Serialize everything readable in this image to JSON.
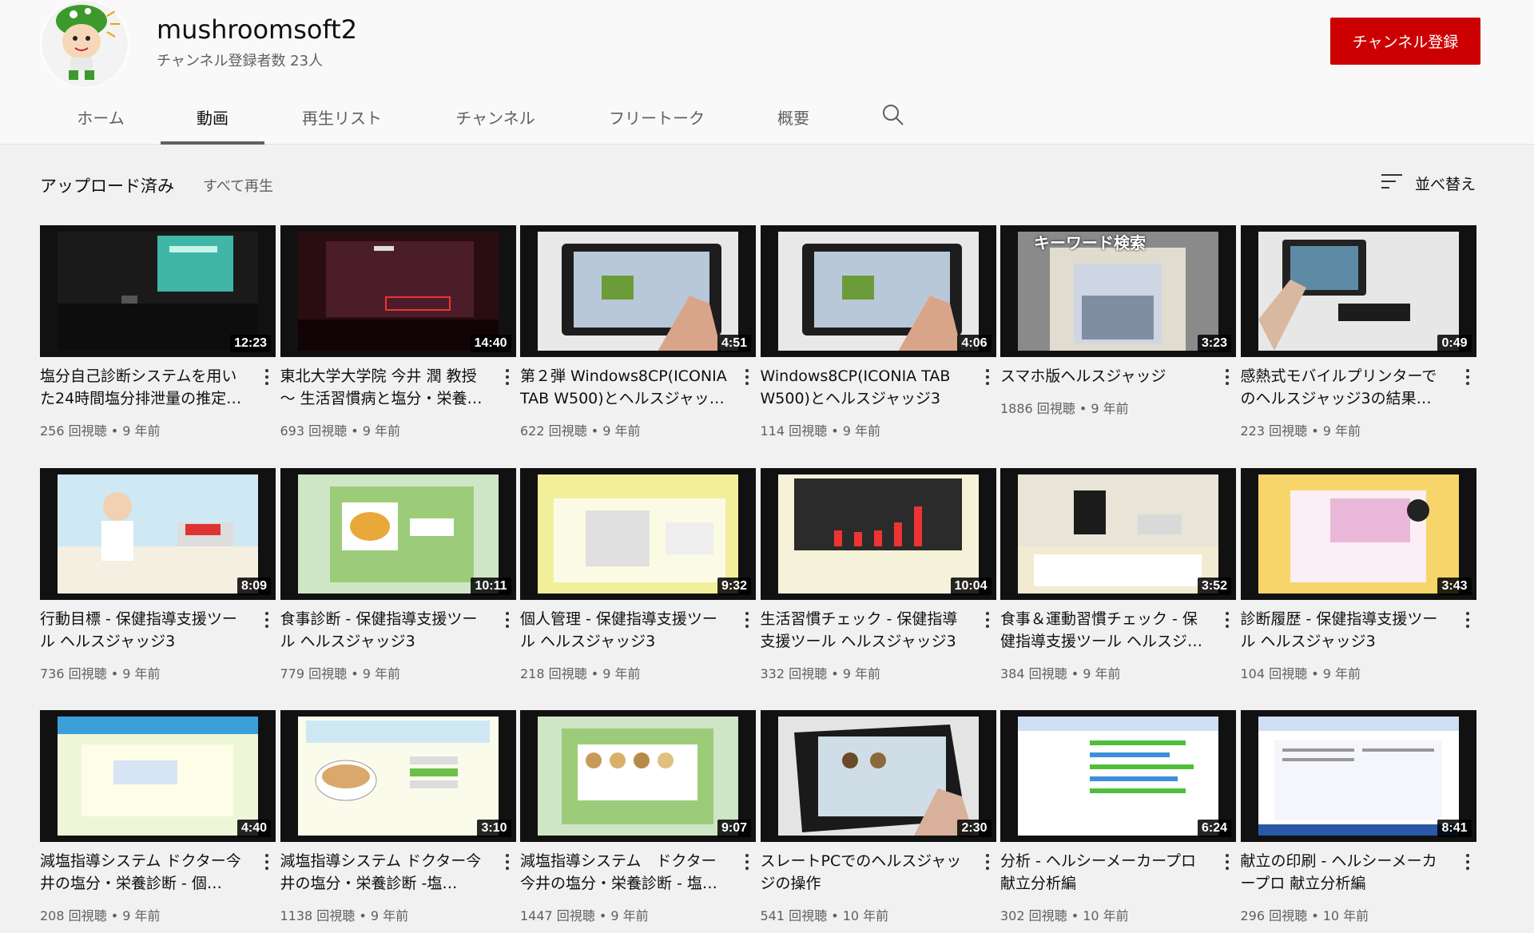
{
  "channel": {
    "name": "mushroomsoft2",
    "subscribers": "チャンネル登録者数 23人",
    "subscribe_label": "チャンネル登録"
  },
  "tabs": [
    {
      "label": "ホーム",
      "active": false
    },
    {
      "label": "動画",
      "active": true
    },
    {
      "label": "再生リスト",
      "active": false
    },
    {
      "label": "チャンネル",
      "active": false
    },
    {
      "label": "フリートーク",
      "active": false
    },
    {
      "label": "概要",
      "active": false
    }
  ],
  "section": {
    "title": "アップロード済み",
    "play_all": "すべて再生",
    "sort_label": "並べ替え"
  },
  "colors": {
    "subscribe": "#cc0000",
    "background": "#f1f1f1",
    "header": "#f9f9f9"
  },
  "videos": [
    {
      "title": "塩分自己診断システムを用いた24時間塩分排泄量の推定…",
      "meta": "256 回視聴 • 9 年前",
      "duration": "12:23",
      "thumb": "lecture"
    },
    {
      "title": "東北大学大学院 今井 潤 教授 ～ 生活習慣病と塩分・栄養…",
      "meta": "693 回視聴 • 9 年前",
      "duration": "14:40",
      "thumb": "lecture-dark"
    },
    {
      "title": "第２弾 Windows8CP(ICONIA TAB W500)とヘルスジャッ…",
      "meta": "622 回視聴 • 9 年前",
      "duration": "4:51",
      "thumb": "tablet"
    },
    {
      "title": "Windows8CP(ICONIA TAB W500)とヘルスジャッジ3",
      "meta": "114 回視聴 • 9 年前",
      "duration": "4:06",
      "thumb": "tablet"
    },
    {
      "title": "スマホ版ヘルスジャッジ",
      "meta": "1886 回視聴 • 9 年前",
      "duration": "3:23",
      "thumb": "phone",
      "overlay": "キーワード検索"
    },
    {
      "title": "感熱式モバイルプリンターでのヘルスジャッジ3の結果…",
      "meta": "223 回視聴 • 9 年前",
      "duration": "0:49",
      "thumb": "printer"
    },
    {
      "title": "行動目標 - 保健指導支援ツール ヘルスジャッジ3",
      "meta": "736 回視聴 • 9 年前",
      "duration": "8:09",
      "thumb": "doctor"
    },
    {
      "title": "食事診断 - 保健指導支援ツール ヘルスジャッジ3",
      "meta": "779 回視聴 • 9 年前",
      "duration": "10:11",
      "thumb": "food-app"
    },
    {
      "title": "個人管理 - 保健指導支援ツール ヘルスジャッジ3",
      "meta": "218 回視聴 • 9 年前",
      "duration": "9:32",
      "thumb": "yellow-app"
    },
    {
      "title": "生活習慣チェック - 保健指導支援ツール ヘルスジャッジ3",
      "meta": "332 回視聴 • 9 年前",
      "duration": "10:04",
      "thumb": "chart-app"
    },
    {
      "title": "食事＆運動習慣チェック - 保健指導支援ツール ヘルスジ…",
      "meta": "384 回視聴 • 9 年前",
      "duration": "3:52",
      "thumb": "room-app"
    },
    {
      "title": "診断履歴 - 保健指導支援ツール ヘルスジャッジ3",
      "meta": "104 回視聴 • 9 年前",
      "duration": "3:43",
      "thumb": "pink-app"
    },
    {
      "title": "減塩指導システム ドクター今井の塩分・栄養診断 - 個…",
      "meta": "208 回視聴 • 9 年前",
      "duration": "4:40",
      "thumb": "blue-app"
    },
    {
      "title": "減塩指導システム ドクター今井の塩分・栄養診断 -塩…",
      "meta": "1138 回視聴 • 9 年前",
      "duration": "3:10",
      "thumb": "ramen"
    },
    {
      "title": "減塩指導システム　ドクター今井の塩分・栄養診断 - 塩…",
      "meta": "1447 回視聴 • 9 年前",
      "duration": "9:07",
      "thumb": "green-food"
    },
    {
      "title": "スレートPCでのヘルスジャッジの操作",
      "meta": "541 回視聴 • 10 年前",
      "duration": "2:30",
      "thumb": "tablet-food"
    },
    {
      "title": "分析 - ヘルシーメーカープロ献立分析編",
      "meta": "302 回視聴 • 10 年前",
      "duration": "6:24",
      "thumb": "spreadsheet"
    },
    {
      "title": "献立の印刷 - ヘルシーメーカープロ 献立分析編",
      "meta": "296 回視聴 • 10 年前",
      "duration": "8:41",
      "thumb": "spreadsheet2"
    }
  ]
}
